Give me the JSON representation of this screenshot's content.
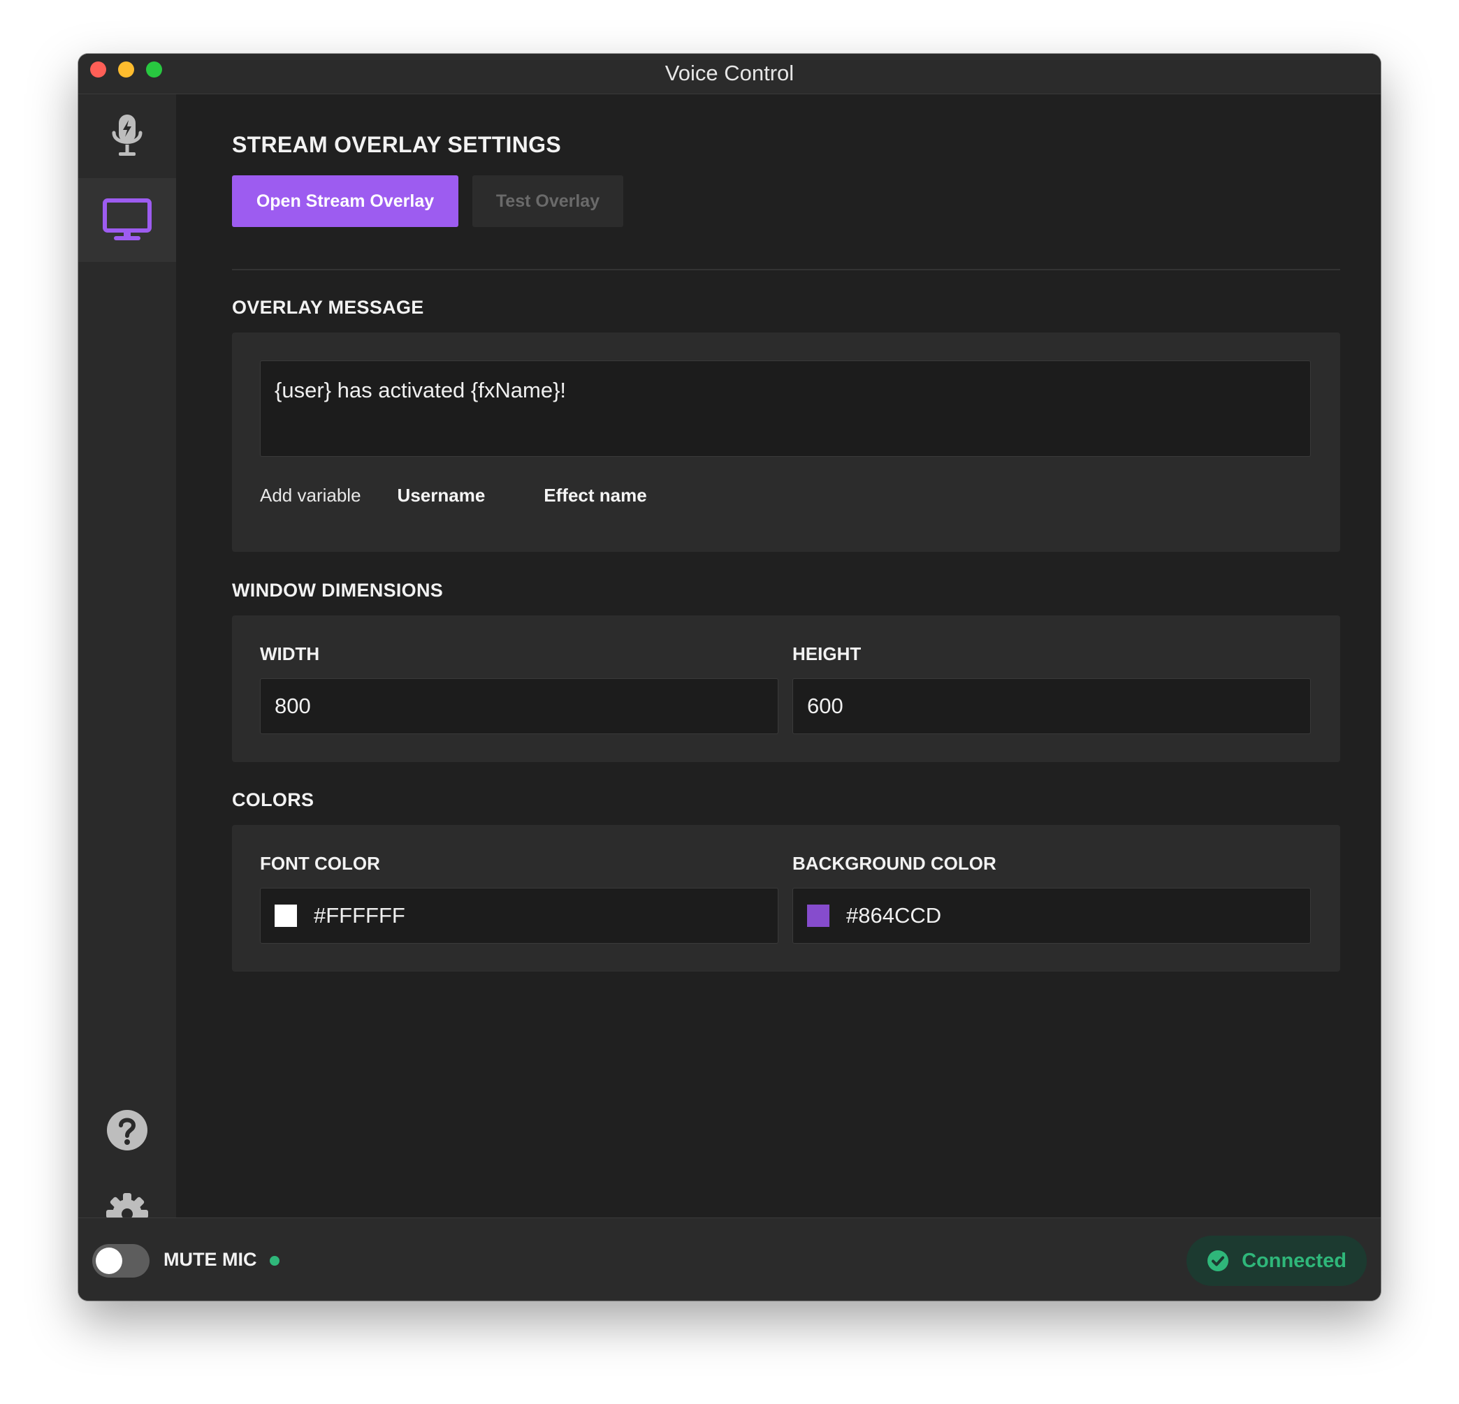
{
  "window": {
    "title": "Voice Control"
  },
  "sidebar": {
    "items": [
      {
        "name": "voice",
        "icon": "microphone-icon",
        "active": false
      },
      {
        "name": "overlay",
        "icon": "monitor-icon",
        "active": true
      },
      {
        "name": "help",
        "icon": "help-icon",
        "active": false
      },
      {
        "name": "settings",
        "icon": "gear-icon",
        "active": false
      }
    ]
  },
  "main": {
    "title": "STREAM OVERLAY SETTINGS",
    "open_overlay_label": "Open Stream Overlay",
    "test_overlay_label": "Test Overlay",
    "overlay_message": {
      "title": "OVERLAY MESSAGE",
      "value": "{user} has activated {fxName}!",
      "add_variable_label": "Add variable",
      "variables": [
        "Username",
        "Effect name"
      ]
    },
    "dimensions": {
      "title": "WINDOW DIMENSIONS",
      "width_label": "WIDTH",
      "width_value": "800",
      "height_label": "HEIGHT",
      "height_value": "600"
    },
    "colors": {
      "title": "COLORS",
      "font_color_label": "FONT COLOR",
      "font_color_value": "#FFFFFF",
      "background_color_label": "BACKGROUND COLOR",
      "background_color_value": "#864CCD"
    }
  },
  "footer": {
    "mute_label": "MUTE MIC",
    "mute_on": false,
    "status_label": "Connected"
  },
  "theme": {
    "accent": "#9d5cf0",
    "success": "#2fb77a",
    "background": "#202020",
    "panel": "#2c2c2c"
  }
}
